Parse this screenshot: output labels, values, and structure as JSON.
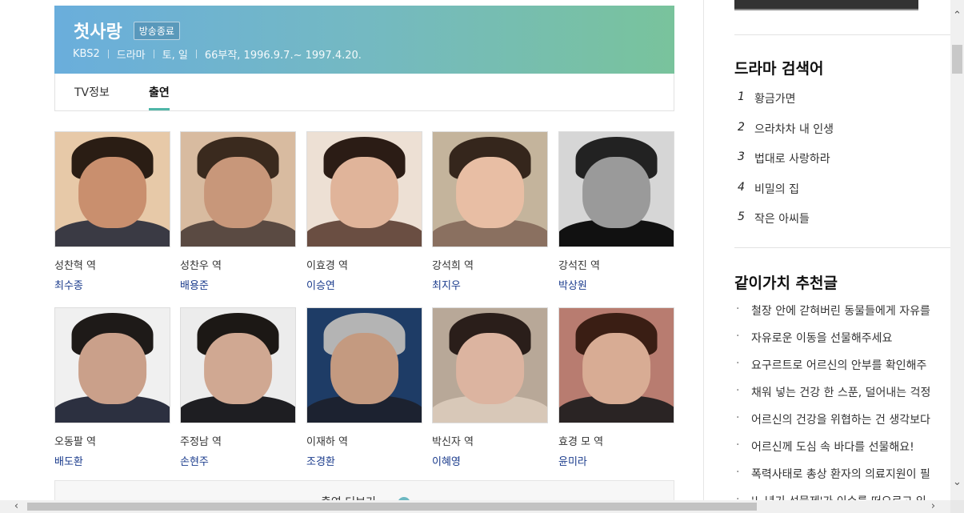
{
  "header": {
    "title": "첫사랑",
    "badge": "방송종료",
    "meta": [
      "KBS2",
      "드라마",
      "토, 일",
      "66부작, 1996.9.7.~ 1997.4.20."
    ]
  },
  "tabs": [
    {
      "label": "TV정보",
      "active": false
    },
    {
      "label": "출연",
      "active": true
    }
  ],
  "cast": [
    {
      "role": "성찬혁 역",
      "actor": "최수종",
      "tone": "#c98f6e",
      "hair": "#2a1d14",
      "bg": "#e7c9a8",
      "body": "#3a3a44"
    },
    {
      "role": "성찬우 역",
      "actor": "배용준",
      "tone": "#c8977a",
      "hair": "#3a2a1e",
      "bg": "#d8bba0",
      "body": "#5a4a42"
    },
    {
      "role": "이효경 역",
      "actor": "이승연",
      "tone": "#e0b49a",
      "hair": "#2b1c15",
      "bg": "#ede0d4",
      "body": "#6a4e42"
    },
    {
      "role": "강석희 역",
      "actor": "최지우",
      "tone": "#e8bea4",
      "hair": "#35261c",
      "bg": "#c4b49c",
      "body": "#8a7060"
    },
    {
      "role": "강석진 역",
      "actor": "박상원",
      "tone": "#9a9a9a",
      "hair": "#222",
      "bg": "#d6d6d6",
      "body": "#111"
    },
    {
      "role": "오동팔 역",
      "actor": "배도환",
      "tone": "#caa08a",
      "hair": "#1e1a18",
      "bg": "#f0f0f0",
      "body": "#2c3040"
    },
    {
      "role": "주정남 역",
      "actor": "손현주",
      "tone": "#d0a892",
      "hair": "#1c1815",
      "bg": "#ececec",
      "body": "#1e1e22"
    },
    {
      "role": "이재하 역",
      "actor": "조경환",
      "tone": "#c49a80",
      "hair": "#b4b4b4",
      "bg": "#1e3c66",
      "body": "#1c2230"
    },
    {
      "role": "박신자 역",
      "actor": "이혜영",
      "tone": "#dcb4a0",
      "hair": "#2a1e1a",
      "bg": "#b8a898",
      "body": "#d8c8b8"
    },
    {
      "role": "효경 모 역",
      "actor": "윤미라",
      "tone": "#d8ac94",
      "hair": "#3a1e14",
      "bg": "#b87c70",
      "body": "#2a2424"
    }
  ],
  "more": {
    "label": "출연 더보기"
  },
  "sidebar": {
    "search_title": "드라마 검색어",
    "ranks": [
      {
        "num": "1",
        "text": "황금가면"
      },
      {
        "num": "2",
        "text": "으라차차 내 인생"
      },
      {
        "num": "3",
        "text": "법대로 사랑하라"
      },
      {
        "num": "4",
        "text": "비밀의 집"
      },
      {
        "num": "5",
        "text": "작은 아씨들"
      }
    ],
    "rec_title": "같이가치 추천글",
    "recs": [
      "철장 안에 갇혀버린 동물들에게 자유를",
      "자유로운 이동을 선물해주세요",
      "요구르트로 어르신의 안부를 확인해주",
      "채워 넣는 건강 한 스푼, 덜어내는 걱정",
      "어르신의 건강을 위협하는 건 생각보다",
      "어르신께 도심 속 바다를 선물해요!",
      "폭력사태로 총상 환자의 의료지원이 필",
      "'노년기 선물제'가 이슈를 떠오르고 있"
    ]
  },
  "scroll": {
    "up": "⌃",
    "down": "⌄",
    "left": "‹",
    "right": "›"
  }
}
